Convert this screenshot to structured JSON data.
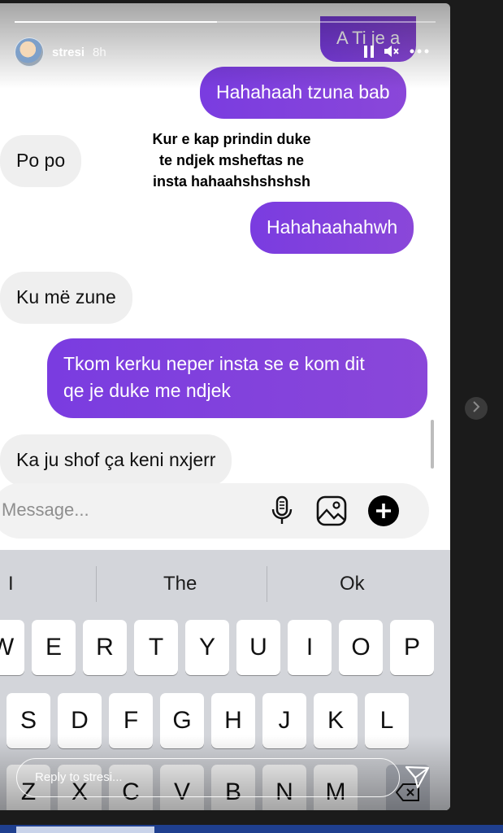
{
  "story": {
    "progress_fraction": 0.48,
    "username": "stresi",
    "time_ago": "8h",
    "caption_lines": [
      "Kur e kap prindin duke",
      "te ndjek msheftas ne",
      "insta hahaahshshshsh"
    ],
    "reply_placeholder": "Reply to stresi..."
  },
  "messages": [
    {
      "id": "m1",
      "dir": "out",
      "text": "A Ti je a"
    },
    {
      "id": "m2",
      "dir": "out",
      "text": "Hahahaah tzuna bab"
    },
    {
      "id": "m3",
      "dir": "in",
      "text": "Po po"
    },
    {
      "id": "m4",
      "dir": "out",
      "text": "Hahahaahahwh"
    },
    {
      "id": "m5",
      "dir": "in",
      "text": "Ku më zune"
    },
    {
      "id": "m6",
      "dir": "out",
      "lines": [
        "Tkom kerku neper insta se e kom dit",
        "qe je duke me ndjek"
      ]
    },
    {
      "id": "m7",
      "dir": "in",
      "text": "Ka ju shof ça keni nxjerr"
    }
  ],
  "composer": {
    "placeholder": "Message..."
  },
  "keyboard": {
    "suggestions": [
      "I",
      "The",
      "Ok"
    ],
    "row1": [
      "W",
      "E",
      "R",
      "T",
      "Y",
      "U",
      "I",
      "O",
      "P"
    ],
    "row2": [
      "S",
      "D",
      "F",
      "G",
      "H",
      "J",
      "K",
      "L"
    ],
    "row3": [
      "Z",
      "X",
      "C",
      "V",
      "B",
      "N",
      "M"
    ]
  },
  "colors": {
    "outgoing_bubble": "#7a3fd6",
    "incoming_bubble": "#efefef",
    "keyboard_bg": "#d3d5da"
  }
}
